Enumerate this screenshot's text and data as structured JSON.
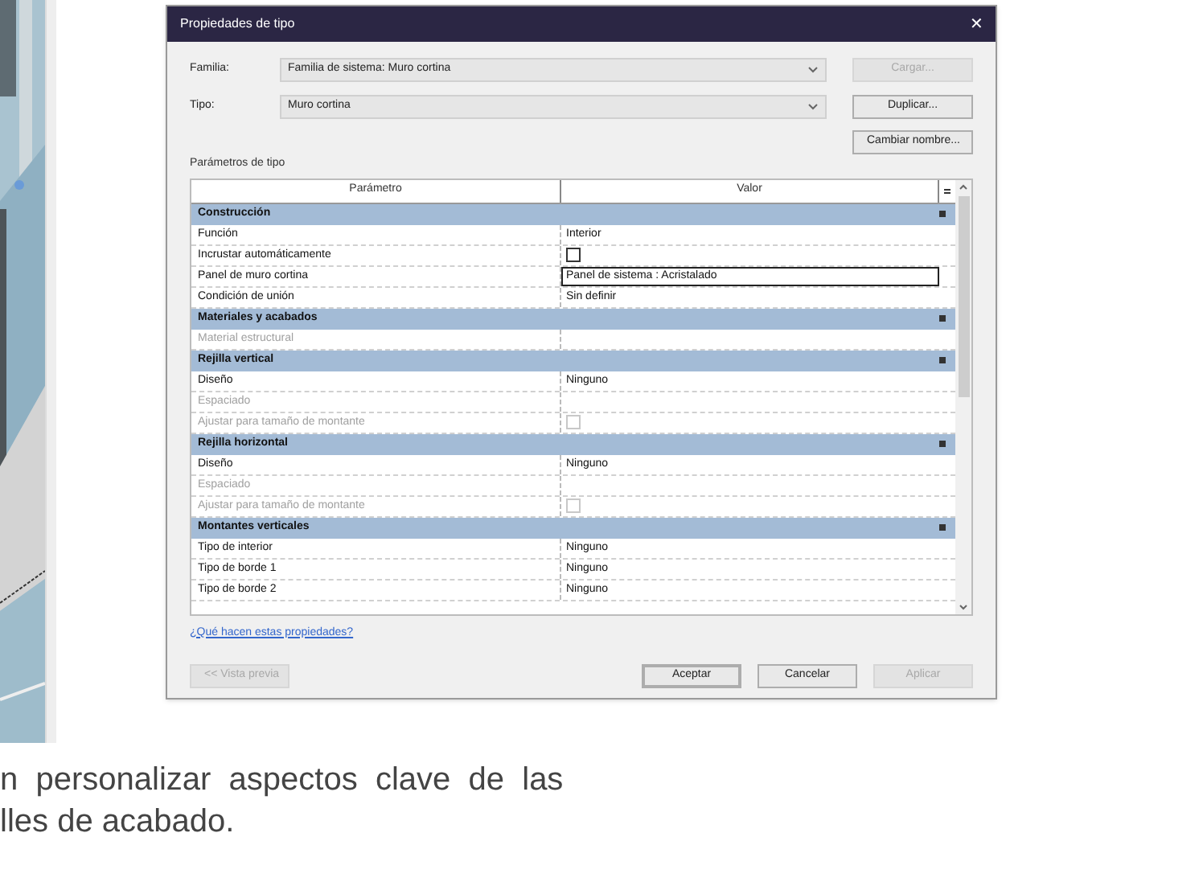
{
  "dialog": {
    "title": "Propiedades de tipo",
    "close": "✕",
    "family": {
      "label": "Familia:",
      "value": "Familia de sistema: Muro cortina"
    },
    "type": {
      "label": "Tipo:",
      "value": "Muro cortina"
    },
    "side_buttons": [
      {
        "label": "Cargar...",
        "disabled": true
      },
      {
        "label": "Duplicar...",
        "disabled": false
      },
      {
        "label": "Cambiar nombre...",
        "disabled": false
      }
    ],
    "section_label": "Parámetros de tipo",
    "table": {
      "columns": [
        "Parámetro",
        "Valor"
      ],
      "rows": [
        {
          "kind": "group",
          "name": "Construcción"
        },
        {
          "kind": "text",
          "name": "Función",
          "value": "Interior",
          "disabled": false,
          "selected": false
        },
        {
          "kind": "checkbox",
          "name": "Incrustar automáticamente",
          "checked": false,
          "disabled": false
        },
        {
          "kind": "text",
          "name": "Panel de muro cortina",
          "value": "Panel de sistema : Acristalado",
          "disabled": false,
          "selected": true
        },
        {
          "kind": "text",
          "name": "Condición de unión",
          "value": "Sin definir",
          "disabled": false,
          "selected": false
        },
        {
          "kind": "group",
          "name": "Materiales y acabados"
        },
        {
          "kind": "text",
          "name": "Material estructural",
          "disabled": true,
          "selected": false
        },
        {
          "kind": "group",
          "name": "Rejilla vertical"
        },
        {
          "kind": "text",
          "name": "Diseño",
          "value": "Ninguno",
          "disabled": false,
          "selected": false
        },
        {
          "kind": "text",
          "name": "Espaciado",
          "disabled": true,
          "selected": false
        },
        {
          "kind": "checkbox",
          "name": "Ajustar para tamaño de montante",
          "checked": false,
          "disabled": true
        },
        {
          "kind": "group",
          "name": "Rejilla horizontal"
        },
        {
          "kind": "text",
          "name": "Diseño",
          "value": "Ninguno",
          "disabled": false,
          "selected": false
        },
        {
          "kind": "text",
          "name": "Espaciado",
          "disabled": true,
          "selected": false
        },
        {
          "kind": "checkbox",
          "name": "Ajustar para tamaño de montante",
          "checked": false,
          "disabled": true
        },
        {
          "kind": "group",
          "name": "Montantes verticales"
        },
        {
          "kind": "text",
          "name": "Tipo de interior",
          "value": "Ninguno",
          "disabled": false,
          "selected": false
        },
        {
          "kind": "text",
          "name": "Tipo de borde 1",
          "value": "Ninguno",
          "disabled": false,
          "selected": false
        },
        {
          "kind": "text",
          "name": "Tipo de borde 2",
          "value": "Ninguno",
          "disabled": false,
          "selected": false
        }
      ]
    },
    "help_link": "¿Qué hacen estas propiedades?",
    "bottom_buttons": [
      {
        "label": "<< Vista previa",
        "disabled": true,
        "default": false
      },
      {
        "label": "Aceptar",
        "disabled": false,
        "default": true
      },
      {
        "label": "Cancelar",
        "disabled": false,
        "default": false
      },
      {
        "label": "Aplicar",
        "disabled": true,
        "default": false
      }
    ]
  },
  "body_text": [
    "n  personalizar  aspectos  clave  de  las",
    "lles de acabado."
  ]
}
